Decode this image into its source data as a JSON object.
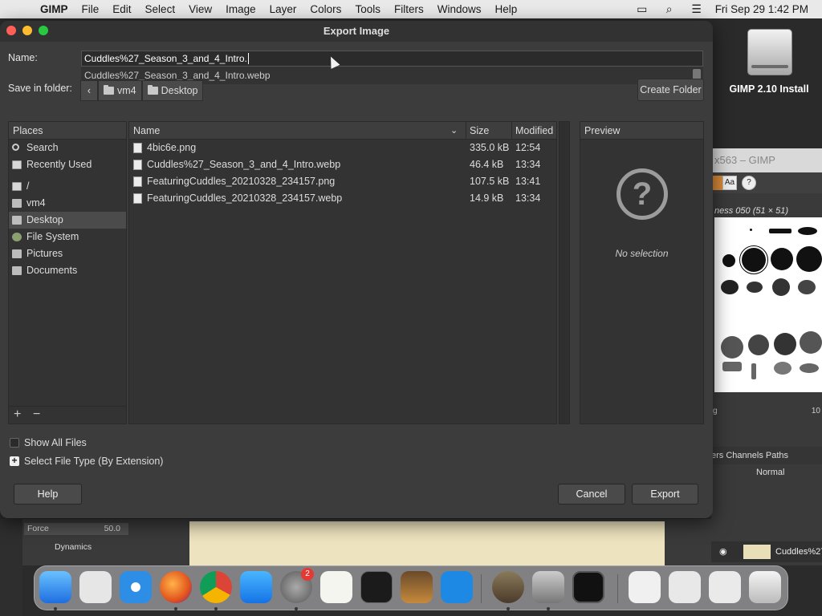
{
  "menubar": {
    "items": [
      "GIMP",
      "File",
      "Edit",
      "Select",
      "View",
      "Image",
      "Layer",
      "Colors",
      "Tools",
      "Filters",
      "Windows",
      "Help"
    ],
    "clock": "Fri Sep 29  1:42 PM"
  },
  "desktop": {
    "drive_label": "GIMP 2.10 Install"
  },
  "bg_gimp": {
    "title": "x563 – GIMP",
    "brush_label": "ness 050 (51 × 51)",
    "tabs": "ers  Channels  Paths",
    "mode": "Normal",
    "layer": "Cuddles%27",
    "force_label": "Force",
    "force_value": "50.0",
    "dynamics": "Dynamics",
    "tb_text": "Aa"
  },
  "dialog": {
    "title": "Export Image",
    "name_label": "Name:",
    "name_value": "Cuddles%27_Season_3_and_4_Intro.",
    "autocomplete": "Cuddles%27_Season_3_and_4_Intro.webp",
    "folder_label": "Save in folder:",
    "breadcrumbs": [
      "vm4",
      "Desktop"
    ],
    "create_folder": "Create Folder",
    "places_header": "Places",
    "places": [
      {
        "label": "Search",
        "icon": "search-icon"
      },
      {
        "label": "Recently Used",
        "icon": "recent-icon"
      },
      {
        "label": "/",
        "icon": "drive-icon"
      },
      {
        "label": "vm4",
        "icon": "home-folder-icon"
      },
      {
        "label": "Desktop",
        "icon": "folder-icon"
      },
      {
        "label": "File System",
        "icon": "filesystem-icon"
      },
      {
        "label": "Pictures",
        "icon": "folder-icon"
      },
      {
        "label": "Documents",
        "icon": "folder-icon"
      }
    ],
    "columns": {
      "name": "Name",
      "size": "Size",
      "modified": "Modified"
    },
    "files": [
      {
        "name": "4bic6e.png",
        "size": "335.0 kB",
        "modified": "12:54"
      },
      {
        "name": "Cuddles%27_Season_3_and_4_Intro.webp",
        "size": "46.4 kB",
        "modified": "13:34"
      },
      {
        "name": "FeaturingCuddles_20210328_234157.png",
        "size": "107.5 kB",
        "modified": "13:41"
      },
      {
        "name": "FeaturingCuddles_20210328_234157.webp",
        "size": "14.9 kB",
        "modified": "13:34"
      }
    ],
    "preview_header": "Preview",
    "no_selection": "No selection",
    "show_all_files": "Show All Files",
    "select_file_type": "Select File Type (By Extension)",
    "help": "Help",
    "cancel": "Cancel",
    "export": "Export"
  },
  "dock": {
    "settings_badge": "2"
  }
}
